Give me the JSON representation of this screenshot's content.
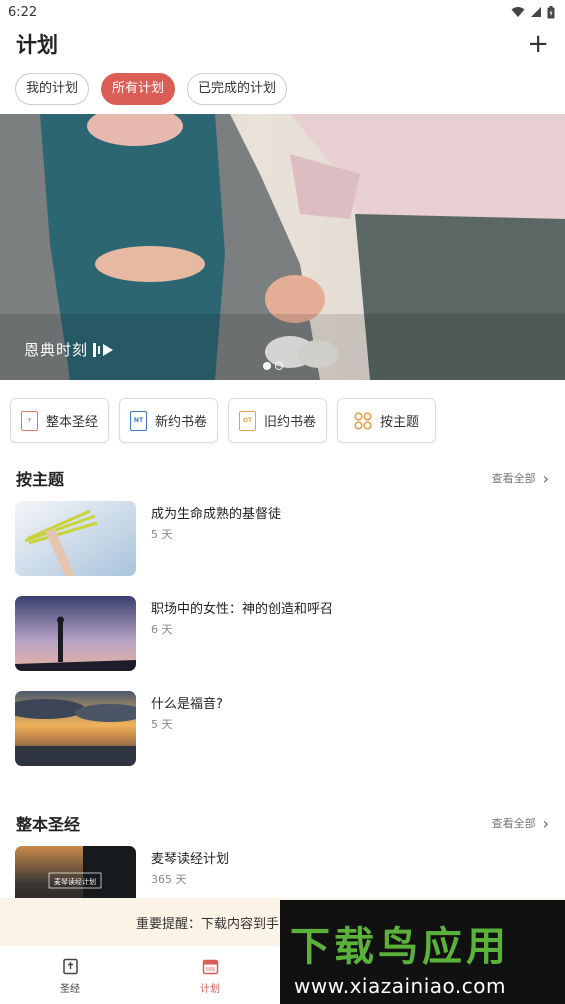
{
  "status_bar": {
    "time": "6:22"
  },
  "header": {
    "title": "计划",
    "add_label": "+"
  },
  "chips": [
    {
      "label": "我的计划",
      "active": false
    },
    {
      "label": "所有计划",
      "active": true
    },
    {
      "label": "已完成的计划",
      "active": false
    }
  ],
  "banner": {
    "caption": "恩典时刻",
    "slides": 2,
    "current_slide": 1
  },
  "quick_actions": [
    {
      "label": "整本圣经",
      "icon": "bible-book-icon"
    },
    {
      "label": "新约书卷",
      "icon": "nt-book-icon",
      "badge": "NT"
    },
    {
      "label": "旧约书卷",
      "icon": "ot-book-icon",
      "badge": "OT"
    },
    {
      "label": "按主题",
      "icon": "topic-grid-icon"
    }
  ],
  "sections": [
    {
      "title": "按主题",
      "see_all": "查看全部",
      "items": [
        {
          "title": "成为生命成熟的基督徒",
          "days": "5 天"
        },
        {
          "title": "职场中的女性：神的创造和呼召",
          "days": "6 天"
        },
        {
          "title": "什么是福音?",
          "days": "5 天"
        }
      ]
    },
    {
      "title": "整本圣经",
      "see_all": "查看全部",
      "items": [
        {
          "title": "麦琴读经计划",
          "days": "365 天",
          "thumb_text": "麦琴读经计划"
        }
      ]
    }
  ],
  "notice": {
    "text": "重要提醒：下载内容到手"
  },
  "watermark": {
    "brand": "下载鸟应用",
    "url": "www.xiazainiao.com"
  },
  "bottom_nav": [
    {
      "label": "圣经",
      "icon": "bible-icon",
      "active": false
    },
    {
      "label": "计划",
      "icon": "calendar-icon",
      "active": true
    }
  ],
  "colors": {
    "accent": "#db5e56",
    "notice_bg": "#fbf3e6",
    "watermark_green": "#5bb23a"
  }
}
